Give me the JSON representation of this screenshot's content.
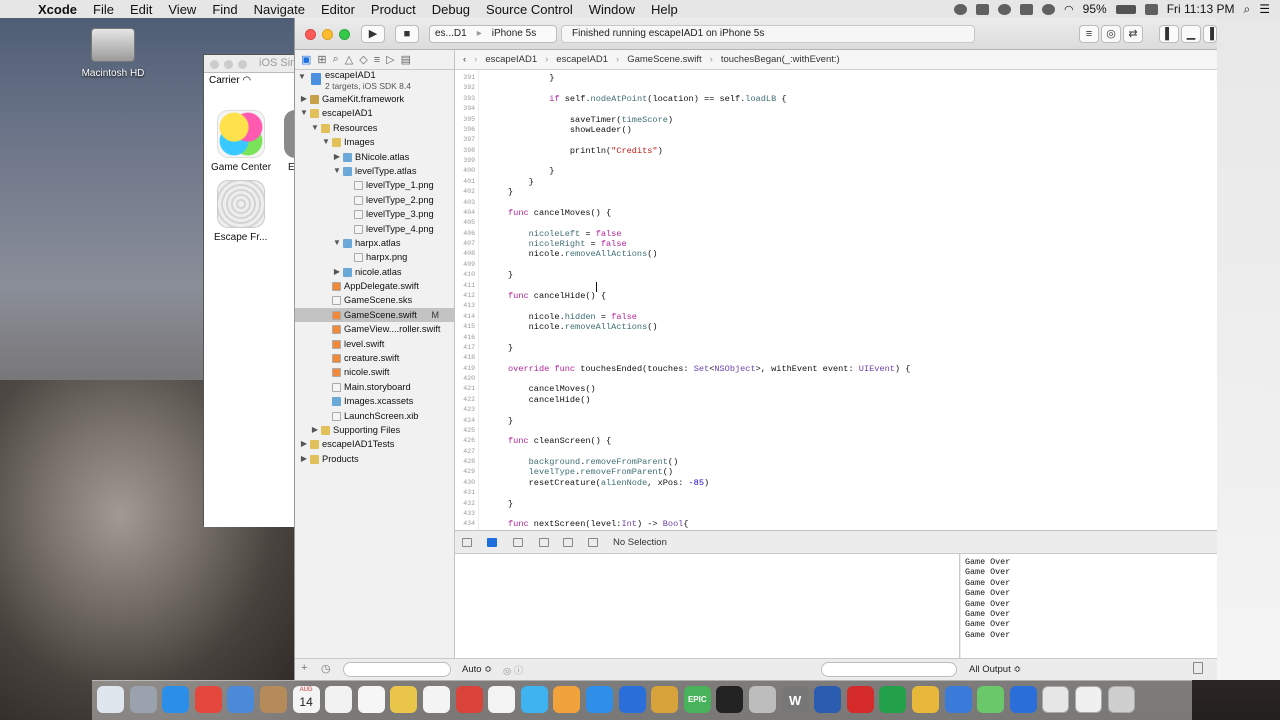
{
  "menubar": {
    "app": "Xcode",
    "items": [
      "File",
      "Edit",
      "View",
      "Find",
      "Navigate",
      "Editor",
      "Product",
      "Debug",
      "Source Control",
      "Window",
      "Help"
    ],
    "battery": "95%",
    "clock": "Fri 11:13 PM"
  },
  "desktop": {
    "hd_label": "Macintosh HD"
  },
  "simulator": {
    "title": "iOS Sim",
    "carrier": "Carrier",
    "apps": [
      "Game Center",
      "Escape Fr..."
    ],
    "partial_label": "E"
  },
  "toolbar": {
    "scheme_target": "es...D1",
    "device": "iPhone 5s",
    "status": "Finished running escapeIAD1 on iPhone 5s"
  },
  "navigator": {
    "project": {
      "name": "escapeIAD1",
      "subtitle": "2 targets, iOS SDK 8.4"
    },
    "items": [
      {
        "label": "GameKit.framework",
        "indent": 1,
        "kind": "framework",
        "disc": "▶"
      },
      {
        "label": "escapeIAD1",
        "indent": 1,
        "kind": "folder",
        "disc": "▼"
      },
      {
        "label": "Resources",
        "indent": 2,
        "kind": "folder",
        "disc": "▼"
      },
      {
        "label": "Images",
        "indent": 3,
        "kind": "folder",
        "disc": "▼"
      },
      {
        "label": "BNicole.atlas",
        "indent": 4,
        "kind": "atlas",
        "disc": "▶"
      },
      {
        "label": "levelType.atlas",
        "indent": 4,
        "kind": "atlas",
        "disc": "▼"
      },
      {
        "label": "levelType_1.png",
        "indent": 5,
        "kind": "file",
        "disc": ""
      },
      {
        "label": "levelType_2.png",
        "indent": 5,
        "kind": "file",
        "disc": ""
      },
      {
        "label": "levelType_3.png",
        "indent": 5,
        "kind": "file",
        "disc": ""
      },
      {
        "label": "levelType_4.png",
        "indent": 5,
        "kind": "file",
        "disc": ""
      },
      {
        "label": "harpx.atlas",
        "indent": 4,
        "kind": "atlas",
        "disc": "▼"
      },
      {
        "label": "harpx.png",
        "indent": 5,
        "kind": "file",
        "disc": ""
      },
      {
        "label": "nicole.atlas",
        "indent": 4,
        "kind": "atlas",
        "disc": "▶"
      },
      {
        "label": "AppDelegate.swift",
        "indent": 3,
        "kind": "swift",
        "disc": ""
      },
      {
        "label": "GameScene.sks",
        "indent": 3,
        "kind": "file",
        "disc": ""
      },
      {
        "label": "GameScene.swift",
        "indent": 3,
        "kind": "swift",
        "disc": "",
        "badge": "M",
        "selected": true
      },
      {
        "label": "GameView....roller.swift",
        "indent": 3,
        "kind": "swift",
        "disc": ""
      },
      {
        "label": "level.swift",
        "indent": 3,
        "kind": "swift",
        "disc": ""
      },
      {
        "label": "creature.swift",
        "indent": 3,
        "kind": "swift",
        "disc": ""
      },
      {
        "label": "nicole.swift",
        "indent": 3,
        "kind": "swift",
        "disc": ""
      },
      {
        "label": "Main.storyboard",
        "indent": 3,
        "kind": "file",
        "disc": ""
      },
      {
        "label": "Images.xcassets",
        "indent": 3,
        "kind": "atlas",
        "disc": ""
      },
      {
        "label": "LaunchScreen.xib",
        "indent": 3,
        "kind": "file",
        "disc": ""
      },
      {
        "label": "Supporting Files",
        "indent": 2,
        "kind": "folder",
        "disc": "▶"
      },
      {
        "label": "escapeIAD1Tests",
        "indent": 1,
        "kind": "folder",
        "disc": "▶"
      },
      {
        "label": "Products",
        "indent": 1,
        "kind": "folder",
        "disc": "▶"
      }
    ]
  },
  "jumpbar": [
    "escapeIAD1",
    "escapeIAD1",
    "GameScene.swift",
    "touchesBegan(_:withEvent:)"
  ],
  "editor": {
    "lines": [
      {
        "n": "391",
        "t": "        }"
      },
      {
        "n": "392",
        "t": ""
      },
      {
        "n": "393",
        "t": "        if self.nodeAtPoint(location) == self.loadLB {"
      },
      {
        "n": "394",
        "t": ""
      },
      {
        "n": "395",
        "t": "            saveTimer(timeScore)"
      },
      {
        "n": "396",
        "t": "            showLeader()"
      },
      {
        "n": "397",
        "t": ""
      },
      {
        "n": "398",
        "t": "            println(\"Credits\")"
      },
      {
        "n": "399",
        "t": ""
      },
      {
        "n": "400",
        "t": "        }"
      },
      {
        "n": "401",
        "t": "    }"
      },
      {
        "n": "402",
        "t": "}"
      },
      {
        "n": "403",
        "t": ""
      },
      {
        "n": "404",
        "t": "func cancelMoves() {"
      },
      {
        "n": "405",
        "t": ""
      },
      {
        "n": "406",
        "t": "    nicoleLeft = false"
      },
      {
        "n": "407",
        "t": "    nicoleRight = false"
      },
      {
        "n": "408",
        "t": "    nicole.removeAllActions()"
      },
      {
        "n": "409",
        "t": ""
      },
      {
        "n": "410",
        "t": "}"
      },
      {
        "n": "411",
        "t": ""
      },
      {
        "n": "412",
        "t": "func cancelHide() {"
      },
      {
        "n": "413",
        "t": ""
      },
      {
        "n": "414",
        "t": "    nicole.hidden = false"
      },
      {
        "n": "415",
        "t": "    nicole.removeAllActions()"
      },
      {
        "n": "416",
        "t": ""
      },
      {
        "n": "417",
        "t": "}"
      },
      {
        "n": "418",
        "t": ""
      },
      {
        "n": "419",
        "t": "override func touchesEnded(touches: Set<NSObject>, withEvent event: UIEvent) {"
      },
      {
        "n": "420",
        "t": ""
      },
      {
        "n": "421",
        "t": "    cancelMoves()"
      },
      {
        "n": "422",
        "t": "    cancelHide()"
      },
      {
        "n": "423",
        "t": ""
      },
      {
        "n": "424",
        "t": "}"
      },
      {
        "n": "425",
        "t": ""
      },
      {
        "n": "426",
        "t": "func cleanScreen() {"
      },
      {
        "n": "427",
        "t": ""
      },
      {
        "n": "428",
        "t": "    background.removeFromParent()"
      },
      {
        "n": "429",
        "t": "    levelType.removeFromParent()"
      },
      {
        "n": "430",
        "t": "    resetCreature(alienNode, xPos: -85)"
      },
      {
        "n": "431",
        "t": ""
      },
      {
        "n": "432",
        "t": "}"
      },
      {
        "n": "433",
        "t": ""
      },
      {
        "n": "434",
        "t": "func nextScreen(level:Int) -> Bool{"
      }
    ]
  },
  "debug": {
    "selection": "No Selection",
    "auto_label": "Auto ≎",
    "output_label": "All Output ≎",
    "console": [
      "Game Over",
      "Game Over",
      "Game Over",
      "Game Over",
      "Game Over",
      "Game Over",
      "Game Over",
      "Game Over"
    ]
  },
  "dock": {
    "calendar_month": "AUG",
    "calendar_day": "14",
    "epic_label": "EPIC",
    "word_label": "W"
  },
  "colors": {
    "keyword": "#b4259a",
    "type": "#6f42a8",
    "string": "#c41a16",
    "number": "#1c00cf",
    "ident": "#3f6e74",
    "accent": "#1d6fe0"
  }
}
